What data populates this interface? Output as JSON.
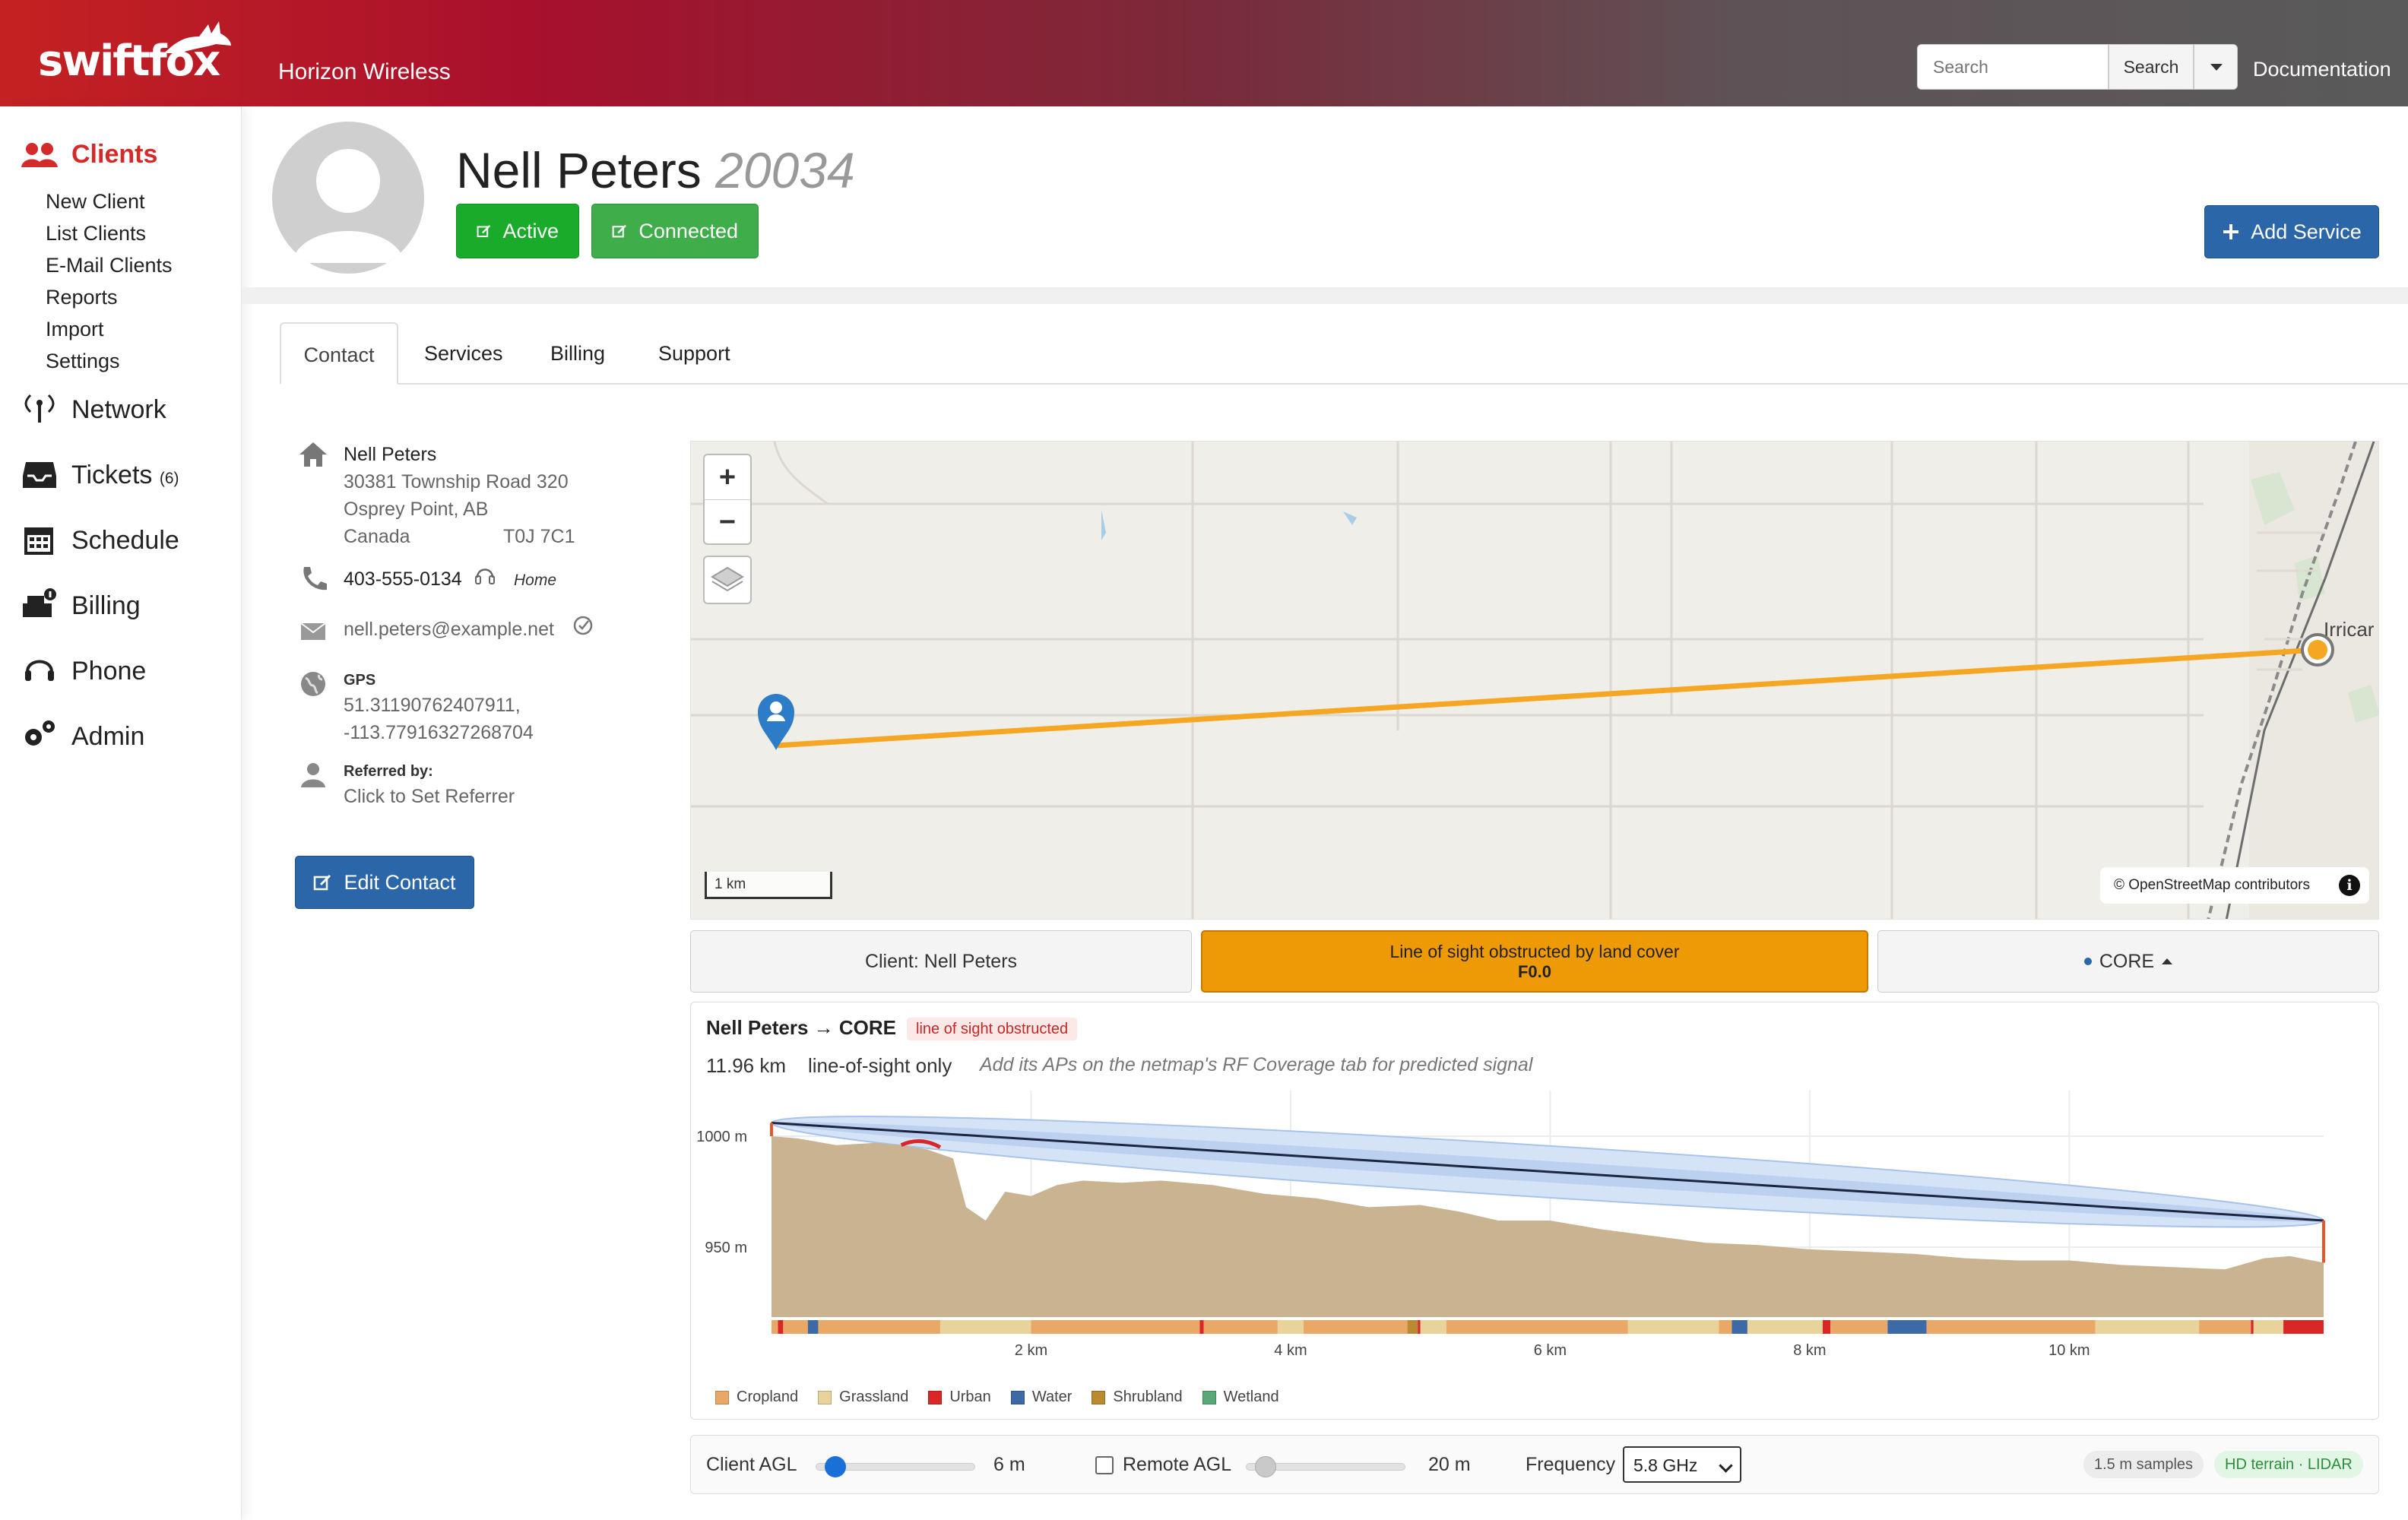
{
  "header": {
    "logo": "swiftfox",
    "organization": "Horizon Wireless",
    "search_placeholder": "Search",
    "search_button": "Search",
    "documentation": "Documentation"
  },
  "sidebar": {
    "clients_label": "Clients",
    "client_subitems": [
      "New Client",
      "List Clients",
      "E-Mail Clients",
      "Reports",
      "Import",
      "Settings"
    ],
    "network_label": "Network",
    "tickets_label": "Tickets",
    "tickets_count": "(6)",
    "schedule_label": "Schedule",
    "billing_label": "Billing",
    "phone_label": "Phone",
    "admin_label": "Admin"
  },
  "client": {
    "name": "Nell Peters",
    "id": "20034",
    "status_active": "Active",
    "status_connected": "Connected",
    "add_service": "Add Service"
  },
  "tabs": [
    "Contact",
    "Services",
    "Billing",
    "Support"
  ],
  "contact": {
    "name": "Nell Peters",
    "address_line1": "30381 Township Road 320",
    "address_line2": "Osprey Point, AB",
    "country": "Canada",
    "postal": "T0J 7C1",
    "phone": "403-555-0134",
    "phone_type": "Home",
    "email": "nell.peters@example.net",
    "gps_label": "GPS",
    "gps_lat": "51.31190762407911,",
    "gps_lon": "-113.77916327268704",
    "referred_label": "Referred by:",
    "referrer": "Click to Set Referrer",
    "edit_button": "Edit Contact"
  },
  "map": {
    "zoom_in": "+",
    "zoom_out": "−",
    "scale": "1 km",
    "attribution": "© OpenStreetMap contributors",
    "town_label": "Irricar",
    "info": "i",
    "link_color": "#f5a623"
  },
  "link_bar": {
    "client_button": "Client: Nell Peters",
    "status_line1": "Line of sight obstructed by land cover",
    "status_line2": "F0.0",
    "status_color": "#ee9a06",
    "remote_button": "CORE"
  },
  "profile": {
    "title": "Nell Peters → CORE",
    "tag": "line of sight obstructed",
    "distance": "11.96 km",
    "mode": "line-of-sight only",
    "hint": "Add its APs on the netmap's RF Coverage tab for predicted signal",
    "legend": [
      {
        "name": "Cropland",
        "color": "#eaa866"
      },
      {
        "name": "Grassland",
        "color": "#e8d49a"
      },
      {
        "name": "Urban",
        "color": "#d92626"
      },
      {
        "name": "Water",
        "color": "#3d6aa6"
      },
      {
        "name": "Shrubland",
        "color": "#b98a30"
      },
      {
        "name": "Wetland",
        "color": "#5aa878"
      }
    ]
  },
  "chart_data": {
    "type": "area",
    "title": "",
    "xlabel": "",
    "ylabel": "",
    "x_ticks": [
      "2 km",
      "4 km",
      "6 km",
      "8 km",
      "10 km"
    ],
    "y_ticks": [
      "1000 m",
      "950 m"
    ],
    "xlim": [
      0,
      11.96
    ],
    "ylim": [
      920,
      1007
    ],
    "terrain_x_km": [
      0,
      0.2,
      0.5,
      0.8,
      1.0,
      1.2,
      1.4,
      1.5,
      1.65,
      1.8,
      2.0,
      2.2,
      2.4,
      2.7,
      3.0,
      3.4,
      3.8,
      4.2,
      4.6,
      5.0,
      5.3,
      5.6,
      6.0,
      6.4,
      6.8,
      7.2,
      7.6,
      8.0,
      8.4,
      8.8,
      9.2,
      9.6,
      10.0,
      10.4,
      10.8,
      11.2,
      11.5,
      11.7,
      11.96
    ],
    "terrain_elev_m": [
      1000,
      999,
      996,
      997,
      996,
      994,
      990,
      968,
      962,
      975,
      973,
      978,
      980,
      979,
      980,
      978,
      974,
      972,
      968,
      969,
      966,
      962,
      962,
      958,
      955,
      952,
      951,
      949,
      948,
      947,
      945,
      944,
      944,
      942,
      941,
      940,
      945,
      946,
      943
    ],
    "sightline": {
      "from_elev_m": 1006,
      "to_elev_m": 962
    },
    "obstruction_km": [
      1.0,
      1.3
    ]
  },
  "controls": {
    "client_agl_label": "Client AGL",
    "client_agl_value": "6 m",
    "client_agl_fraction": 0.03,
    "remote_agl_label": "Remote AGL",
    "remote_agl_value": "20 m",
    "remote_agl_fraction": 0.03,
    "frequency_label": "Frequency",
    "frequency_value": "5.8 GHz",
    "samples_pill": "1.5 m samples",
    "terrain_pill": "HD terrain · LIDAR"
  }
}
